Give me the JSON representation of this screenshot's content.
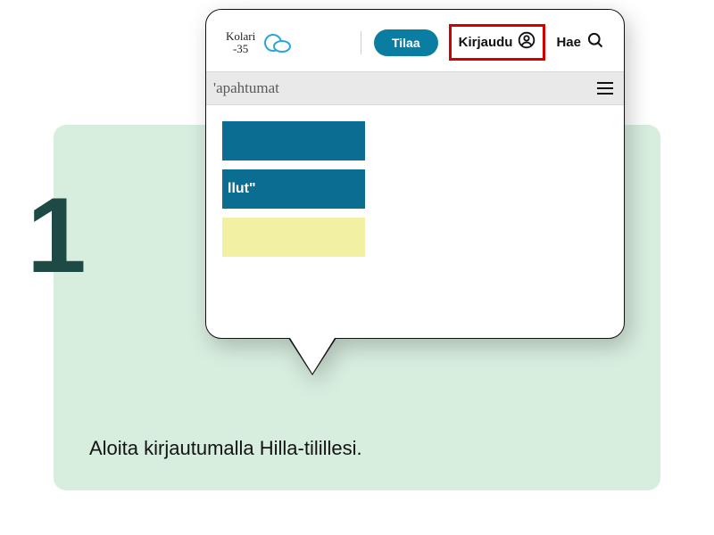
{
  "step_number": "1",
  "instruction": "Aloita kirjautumalla Hilla-tilillesi.",
  "callout": {
    "weather": {
      "city": "Kolari",
      "temp": "-35"
    },
    "subscribe_label": "Tilaa",
    "login_label": "Kirjaudu",
    "search_label": "Hae",
    "nav_text_fragment": "'apahtumat",
    "stub_text_fragment": "llut\""
  }
}
